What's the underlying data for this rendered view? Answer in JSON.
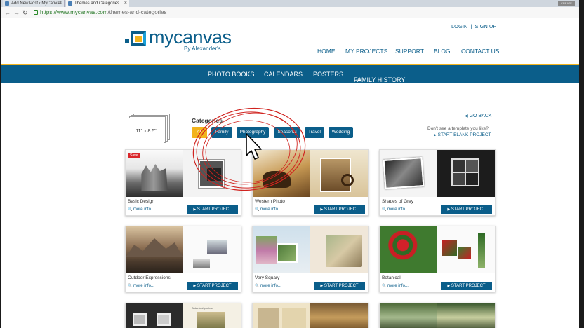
{
  "browser": {
    "tabs": [
      {
        "title": "Add New Post ‹ MyCanvas"
      },
      {
        "title": "Themes and Categories"
      }
    ],
    "window_label": "CREATE",
    "url_host": "https://www.mycanvas.com",
    "url_path": "/themes-and-categories"
  },
  "site": {
    "logo_text": "mycanvas",
    "logo_sub": "By Alexander's",
    "top_links": [
      "LOGIN",
      "SIGN UP"
    ],
    "top_sep": "|",
    "main_nav": [
      "HOME",
      "MY PROJECTS",
      "SUPPORT",
      "BLOG",
      "CONTACT US"
    ],
    "category_nav": [
      "PHOTO BOOKS",
      "CALENDARS",
      "POSTERS",
      "FAMILY HISTORY"
    ],
    "family_history_icon": "⇥"
  },
  "filters": {
    "book_size": "11\" x 8.5\"",
    "title": "Categories",
    "pills": [
      "All",
      "Family",
      "Photography",
      "Seasonal",
      "Travel",
      "Wedding"
    ],
    "active": "All",
    "go_back": "GO BACK",
    "go_back_icon": "◀",
    "not_see": "Don't see a template you like?",
    "start_blank": "START BLANK PROJECT",
    "start_blank_icon": "▶"
  },
  "card_common": {
    "more": "more info...",
    "more_icon": "🔍",
    "start": "START PROJECT",
    "start_icon": "▶",
    "save_badge": "Save"
  },
  "cards": [
    {
      "name": "Basic Design"
    },
    {
      "name": "Western Photo"
    },
    {
      "name": "Shades of Gray"
    },
    {
      "name": "Outdoor Expressions"
    },
    {
      "name": "Very Squary"
    },
    {
      "name": "Botanical"
    },
    {
      "name": ""
    },
    {
      "name": ""
    },
    {
      "name": ""
    }
  ],
  "row3_caption": "Botanical photos",
  "colors": {
    "brand_blue": "#0b5e8a",
    "accent_yellow": "#f2b31c",
    "annotation_red": "#d0231f"
  }
}
